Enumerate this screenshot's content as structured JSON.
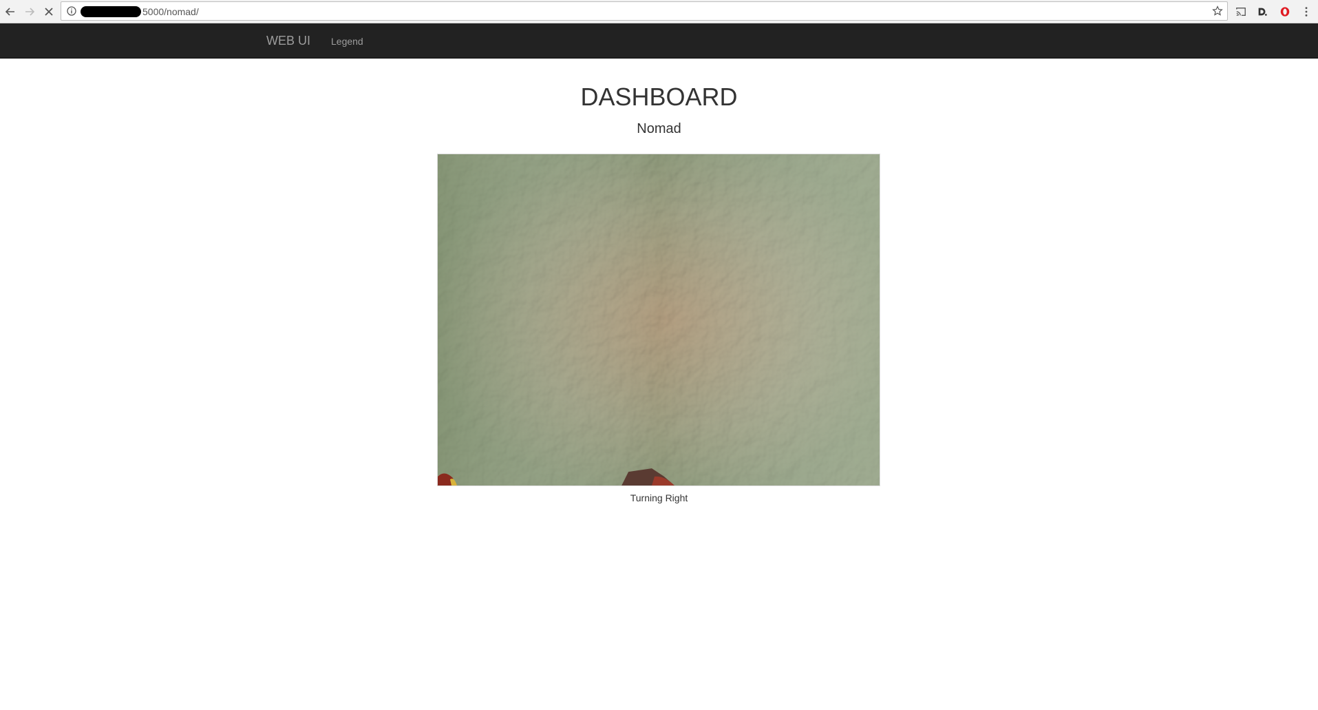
{
  "browser": {
    "url_visible": "5000/nomad/"
  },
  "navbar": {
    "brand": "WEB UI",
    "links": [
      {
        "label": "Legend"
      }
    ]
  },
  "main": {
    "title": "DASHBOARD",
    "subtitle": "Nomad",
    "camera_caption": "Turning Right"
  }
}
